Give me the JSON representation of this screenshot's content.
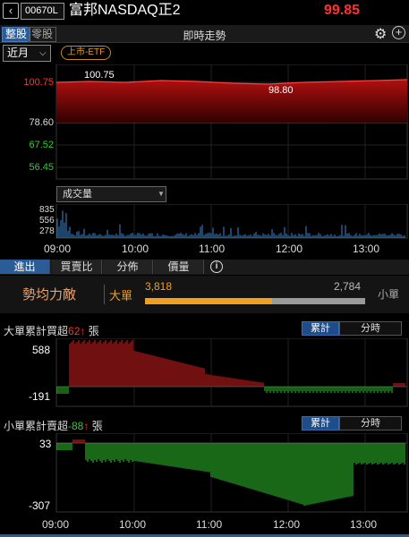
{
  "header": {
    "back_icon": "chevron-left-icon",
    "code": "00670L",
    "name": "富邦NASDAQ正2",
    "price": "99.85",
    "price_color": "#ff3030"
  },
  "tabs": {
    "whole": "整股",
    "odd": "零股",
    "title": "即時走勢",
    "gear_icon": "gear-icon",
    "plus_icon": "plus-circle-icon"
  },
  "period": {
    "selected": "近月",
    "arrow_icon": "chevron-down-icon"
  },
  "badge": "上市-ETF",
  "price_chart": {
    "y_labels": {
      "top": "100.75",
      "mid": "78.60",
      "lower1": "67.52",
      "lower2": "56.45"
    },
    "annotations": {
      "high": "100.75",
      "last": "98.80"
    },
    "accent_up": "#ff3030",
    "accent_down": "#30d030"
  },
  "volume": {
    "selector": "成交量",
    "y_labels": [
      "835",
      "556",
      "278"
    ]
  },
  "time_axis": [
    "09:00",
    "10:00",
    "11:00",
    "12:00",
    "13:00"
  ],
  "bottom_tabs": [
    "進出",
    "買賣比",
    "分佈",
    "價量"
  ],
  "balance": {
    "label": "勢均力敵",
    "big_label": "大單",
    "small_label": "小單",
    "big_value": "3,818",
    "small_value": "2,784",
    "big_ratio": 0.578
  },
  "big_order": {
    "title_prefix": "大單累計買超",
    "value": "62",
    "unit": "張",
    "cumulative": "累計",
    "timeshare": "分時",
    "y_top": "588",
    "y_bottom": "-191"
  },
  "small_order": {
    "title_prefix": "小單累計賣超",
    "value": "-88",
    "unit": "張",
    "cumulative": "累計",
    "timeshare": "分時",
    "y_top": "33",
    "y_bottom": "-307"
  },
  "time_axis_bottom": [
    "09:00",
    "10:00",
    "11:00",
    "12:00",
    "13:00"
  ]
}
